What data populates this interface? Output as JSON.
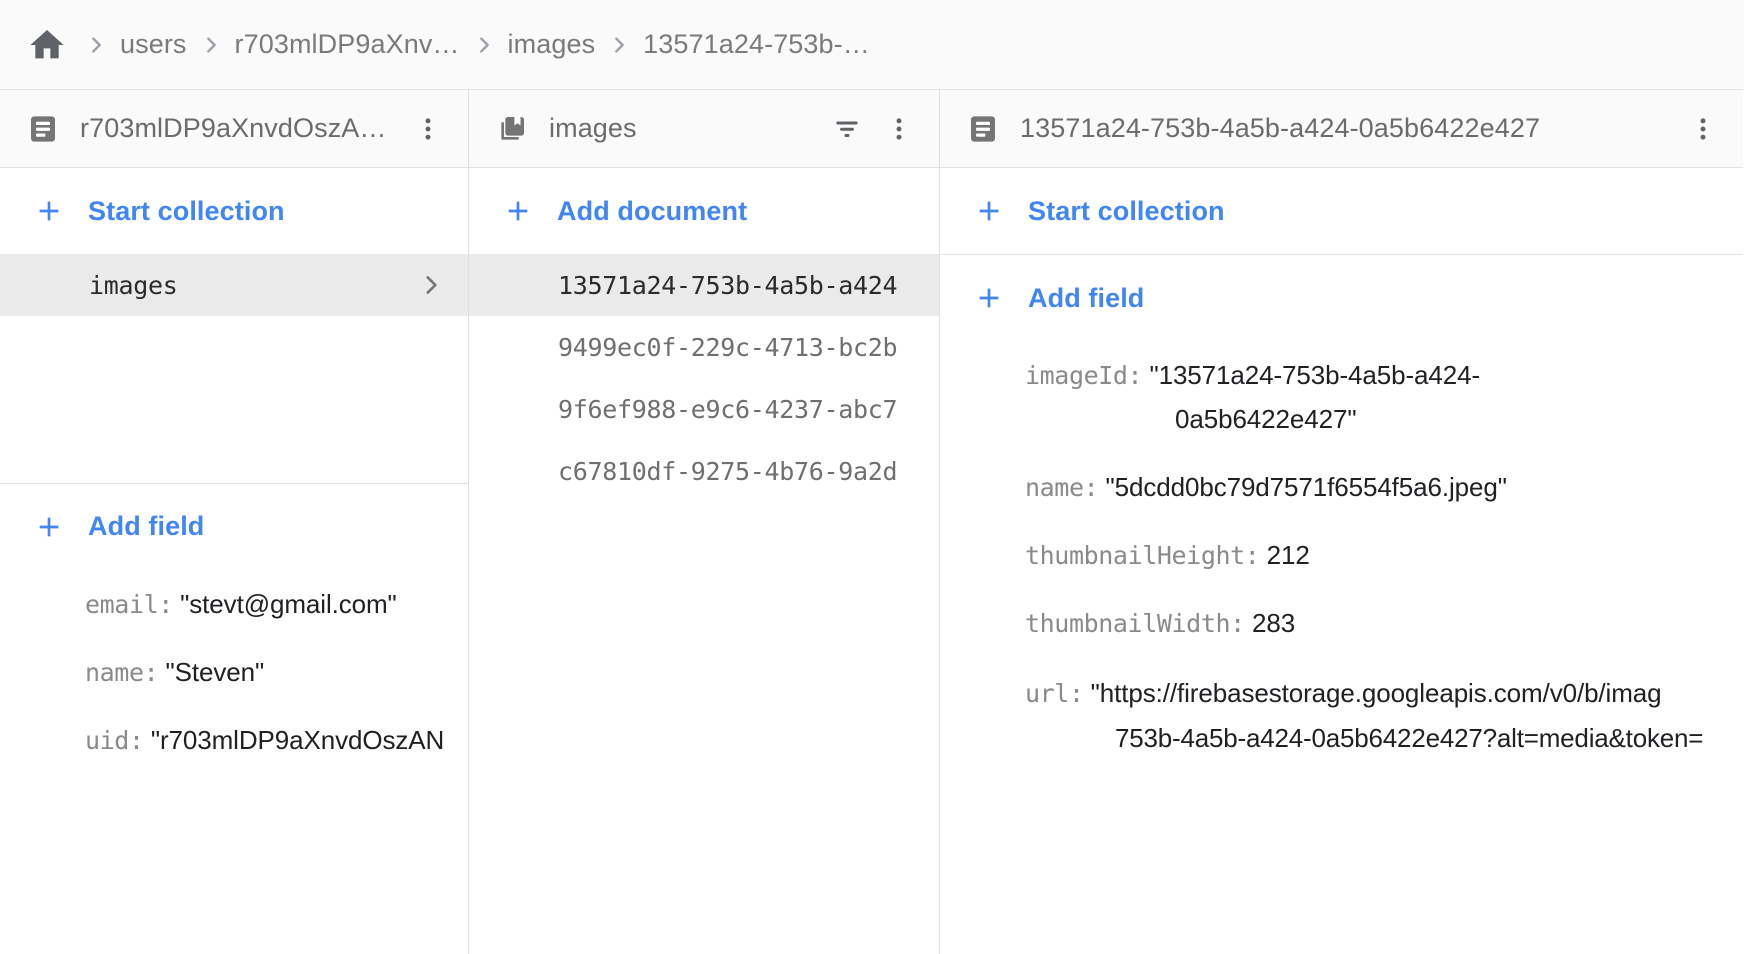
{
  "breadcrumb": {
    "home_icon": "home-icon",
    "separator_icon": "chevron-right-icon",
    "items": [
      {
        "label": "users"
      },
      {
        "label": "r703mlDP9aXnv…"
      },
      {
        "label": "images"
      },
      {
        "label": "13571a24-753b-…"
      }
    ]
  },
  "panels": {
    "document_panel": {
      "icon": "document-icon",
      "title": "r703mlDP9aXnvdOszA…",
      "menu_icon": "more-vert-icon",
      "start_collection_label": "Start collection",
      "plus_icon": "plus-icon",
      "collections": [
        {
          "name": "images",
          "selected": true,
          "chevron_icon": "chevron-right-icon"
        }
      ],
      "add_field_label": "Add field",
      "fields": [
        {
          "key": "email:",
          "value": "\"stevt@gmail.com\""
        },
        {
          "key": "name:",
          "value": "\"Steven\""
        },
        {
          "key": "uid:",
          "value": "\"r703mlDP9aXnvdOszAN"
        }
      ]
    },
    "collection_panel": {
      "icon": "collection-icon",
      "title": "images",
      "filter_icon": "filter-icon",
      "menu_icon": "more-vert-icon",
      "add_document_label": "Add document",
      "plus_icon": "plus-icon",
      "documents": [
        {
          "id": "13571a24-753b-4a5b-a424",
          "selected": true
        },
        {
          "id": "9499ec0f-229c-4713-bc2b",
          "selected": false
        },
        {
          "id": "9f6ef988-e9c6-4237-abc7",
          "selected": false
        },
        {
          "id": "c67810df-9275-4b76-9a2d",
          "selected": false
        }
      ]
    },
    "field_panel": {
      "icon": "document-icon",
      "title": "13571a24-753b-4a5b-a424-0a5b6422e427",
      "menu_icon": "more-vert-icon",
      "start_collection_label": "Start collection",
      "add_field_label": "Add field",
      "plus_icon": "plus-icon",
      "fields": [
        {
          "key": "imageId:",
          "value_line1": "\"13571a24-753b-4a5b-a424-",
          "value_line2": "0a5b6422e427\"",
          "wrapped": true
        },
        {
          "key": "name:",
          "value": "\"5dcdd0bc79d7571f6554f5a6.jpeg\""
        },
        {
          "key": "thumbnailHeight:",
          "value": "212"
        },
        {
          "key": "thumbnailWidth:",
          "value": "283"
        },
        {
          "key": "url:",
          "value_line1": "\"https://firebasestorage.googleapis.com/v0/b/imag",
          "value_line2": "753b-4a5b-a424-0a5b6422e427?alt=media&token=",
          "url": true
        }
      ]
    }
  },
  "colors": {
    "accent": "#4285f4",
    "selected_row_bg": "#eaeaea",
    "header_bg": "#fafafa",
    "icon_grey": "#757575",
    "text_grey": "#6b6b6b"
  }
}
